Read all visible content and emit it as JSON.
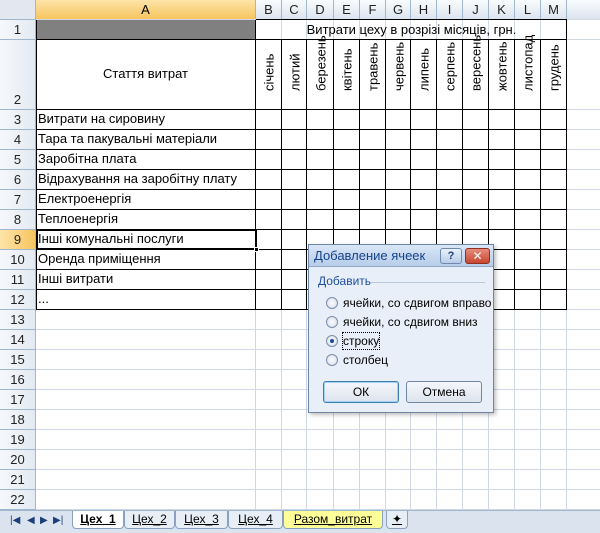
{
  "columns": [
    "A",
    "B",
    "C",
    "D",
    "E",
    "F",
    "G",
    "H",
    "I",
    "J",
    "K",
    "L",
    "M"
  ],
  "rows": [
    "1",
    "2",
    "3",
    "4",
    "5",
    "6",
    "7",
    "8",
    "9",
    "10",
    "11",
    "12",
    "13",
    "14",
    "15",
    "16",
    "17",
    "18",
    "19",
    "20",
    "21",
    "22"
  ],
  "sheet": {
    "header_title": "Витрати цеху в розрізі місяців, грн.",
    "col_a_header": "Стаття витрат",
    "months": [
      "січень",
      "лютий",
      "березень",
      "квітень",
      "травень",
      "червень",
      "липень",
      "серпень",
      "вересень",
      "жовтень",
      "листопад",
      "грудень"
    ],
    "items": [
      "Витрати на сировину",
      "Тара та пакувальні матеріали",
      "Заробітна плата",
      "Відрахування на заробітну плату",
      "Електроенергія",
      "Теплоенергія",
      "Інші комунальні послуги",
      "Оренда приміщення",
      "Інші витрати",
      "..."
    ]
  },
  "dialog": {
    "title": "Добавление ячеек",
    "help": "?",
    "close": "✕",
    "group": "Добавить",
    "options": [
      {
        "label": "ячейки, со сдвигом вправо",
        "selected": false
      },
      {
        "label": "ячейки, со сдвигом вниз",
        "selected": false
      },
      {
        "label": "строку",
        "selected": true
      },
      {
        "label": "столбец",
        "selected": false
      }
    ],
    "ok": "ОК",
    "cancel": "Отмена"
  },
  "tabs": [
    "Цех_1",
    "Цех_2",
    "Цех_3",
    "Цех_4",
    "Разом_витрат"
  ],
  "active_tab": "Цех_1",
  "nav_icons": [
    "first-sheet-icon",
    "prev-sheet-icon",
    "next-sheet-icon",
    "last-sheet-icon"
  ],
  "colors": {
    "header_bg": "#dde4ee",
    "selected_header": "#f7c55f",
    "grid": "#d0d7e5",
    "dialog_title": "#15428b",
    "yellow_tab": "#ffff99"
  }
}
